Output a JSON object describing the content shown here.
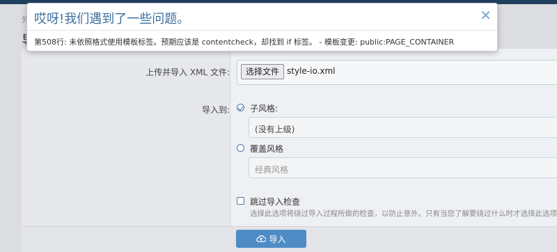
{
  "underlay": {
    "crumb": "外",
    "title": "导"
  },
  "form": {
    "upload_label": "上传并导入 XML 文件:",
    "file_button": "选择文件",
    "file_name": "style-io.xml",
    "import_to_label": "导入到:",
    "child_style_label": "子风格:",
    "parent_select_value": "(没有上级)",
    "overwrite_label": "覆盖风格",
    "overwrite_select_value": "经典风格",
    "skip_check_label": "跳过导入检查",
    "skip_check_explain": "选择此选项将绕过导入过程所做的检查，以防止意外。只有当您了解要绕过什么时才选择此选项。",
    "import_button": "导入"
  },
  "dialog": {
    "title": "哎呀!我们遇到了一些问题。",
    "message": "第508行: 未依照格式使用模板标签。预期应该是 contentcheck，却找到 if 标签。 - 模板变更: public:PAGE_CONTAINER",
    "close_icon": "close-icon"
  },
  "colors": {
    "accent": "#4f8cc6",
    "title": "#3c6f9c",
    "topbar": "#20405e"
  }
}
